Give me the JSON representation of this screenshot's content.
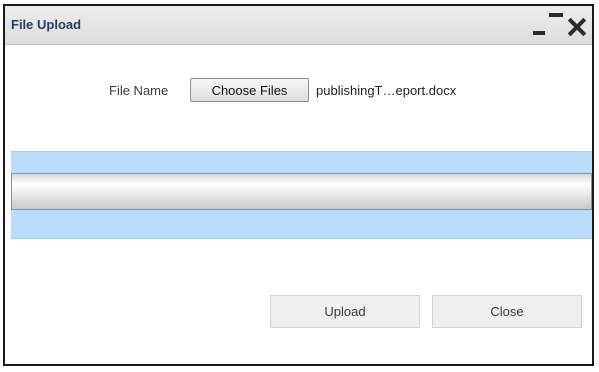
{
  "window": {
    "title": "File Upload",
    "controls": {
      "minimize_icon": "minimize-icon",
      "restore_icon": "restore-icon",
      "close_icon": "close-icon"
    }
  },
  "file_input": {
    "label": "File Name",
    "button_label": "Choose Files",
    "selected_file": "publishingT…eport.docx"
  },
  "progress": {
    "value": 0
  },
  "actions": {
    "upload_label": "Upload",
    "close_label": "Close"
  },
  "colors": {
    "title_text": "#2a3d5c",
    "progress_band": "#bcdcfb",
    "dialog_border": "#1a1a1a"
  }
}
